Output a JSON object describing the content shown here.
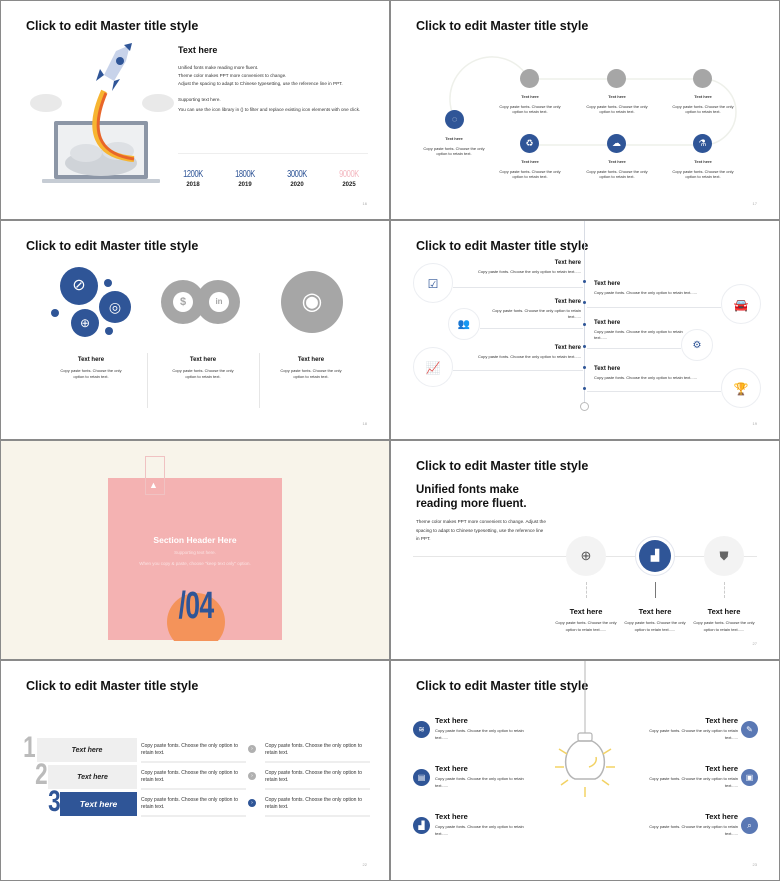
{
  "colors": {
    "accent": "#2f5597",
    "gray": "#a6a6a6",
    "pink": "#f4b2b2",
    "orange": "#f4935a",
    "cream": "#f8f4ea",
    "bulb_yellow": "#f2d264"
  },
  "slides": [
    {
      "title": "Click to edit Master title style",
      "page": "16",
      "heading": "Text here",
      "body_lines": [
        "Unified fonts make reading more fluent.",
        "Theme color makes PPT more convenient to change.",
        "Adjust the spacing to adapt to Chinese typesetting, use the reference line in PPT."
      ],
      "supporting": "Supporting text here.",
      "supporting_body": "You can use the icon library in   () to filter and replace existing icon elements with one click.",
      "stats": [
        {
          "value": "1200K",
          "year": "2018",
          "color": "#2f5597"
        },
        {
          "value": "1800K",
          "year": "2019",
          "color": "#2f5597"
        },
        {
          "value": "3000K",
          "year": "2020",
          "color": "#2f5597"
        },
        {
          "value": "9000K",
          "year": "2025",
          "color": "#f4b8c0"
        }
      ]
    },
    {
      "title": "Click to edit Master title style",
      "page": "17",
      "items": [
        {
          "icon": "lightbulb-icon",
          "label": "Text here",
          "desc": "Copy paste fonts. Choose the only option to retain text."
        },
        {
          "icon": "satellite-icon",
          "label": "Text here",
          "desc": "Copy paste fonts. Choose the only option to retain text."
        },
        {
          "icon": "tools-icon",
          "label": "Text here",
          "desc": "Copy paste fonts. Choose the only option to retain text."
        },
        {
          "icon": "wrench-icon",
          "label": "Text here",
          "desc": "Copy paste fonts. Choose the only option to retain text."
        },
        {
          "icon": "recycle-icon",
          "label": "Text here",
          "desc": "Copy paste fonts. Choose the only option to retain text."
        },
        {
          "icon": "cloud-upload-icon",
          "label": "Text here",
          "desc": "Copy paste fonts. Choose the only option to retain text."
        },
        {
          "icon": "flask-icon",
          "label": "Text here",
          "desc": "Copy paste fonts. Choose the only option to retain text."
        }
      ]
    },
    {
      "title": "Click to edit Master title style",
      "page": "18",
      "columns": [
        {
          "label": "Text here",
          "desc": "Copy paste fonts. Choose the only option to retain text."
        },
        {
          "label": "Text here",
          "desc": "Copy paste fonts. Choose the only option to retain text."
        },
        {
          "label": "Text here",
          "desc": "Copy paste fonts. Choose the only option to retain text."
        }
      ]
    },
    {
      "title": "Click to edit Master title style",
      "page": "19",
      "left": [
        {
          "icon": "checkbox-icon",
          "label": "Text here",
          "desc": "Copy paste fonts. Choose the only option to retain text......"
        },
        {
          "icon": "team-icon",
          "label": "Text here",
          "desc": "Copy paste fonts. Choose the only option to retain text......"
        },
        {
          "icon": "growth-chart-icon",
          "label": "Text here",
          "desc": "Copy paste fonts. Choose the only option to retain text......"
        }
      ],
      "right": [
        {
          "icon": "car-icon",
          "label": "Text here",
          "desc": "Copy paste fonts. Choose the only option to retain text......"
        },
        {
          "icon": "gear-icon",
          "label": "Text here",
          "desc": "Copy paste fonts. Choose the only option to retain text......"
        },
        {
          "icon": "trophy-icon",
          "label": "Text here",
          "desc": "Copy paste fonts. Choose the only option to retain text......"
        }
      ]
    },
    {
      "section_title": "Section Header Here",
      "supporting": "Supporting text here.",
      "note": "When you copy & paste, choose \"keep text only\" option.",
      "number": "/04"
    },
    {
      "title": "Click to edit Master title style",
      "page": "27",
      "heading": "Unified fonts make reading more fluent.",
      "body": "Theme color makes PPT more convenient to change. Adjust the spacing to adapt to Chinese typesetting, use the reference line in PPT.",
      "items": [
        {
          "icon": "globe-icon",
          "label": "Text here",
          "desc": "Copy paste fonts. Choose the only option to retain text......"
        },
        {
          "icon": "bar-chart-icon",
          "label": "Text here",
          "desc": "Copy paste fonts. Choose the only option to retain text......"
        },
        {
          "icon": "shield-icon",
          "label": "Text here",
          "desc": "Copy paste fonts. Choose the only option to retain text......"
        }
      ]
    },
    {
      "title": "Click to edit Master title style",
      "page": "22",
      "rows": [
        {
          "num": "1",
          "label": "Text here",
          "c1": "Copy paste fonts. Choose the only option to retain text.",
          "c2": "Copy paste fonts. Choose the only option to retain text."
        },
        {
          "num": "2",
          "label": "Text here",
          "c1": "Copy paste fonts. Choose the only option to retain text.",
          "c2": "Copy paste fonts. Choose the only option to retain text."
        },
        {
          "num": "3",
          "label": "Text here",
          "c1": "Copy paste fonts. Choose the only option to retain text.",
          "c2": "Copy paste fonts. Choose the only option to retain text."
        }
      ]
    },
    {
      "title": "Click to edit Master title style",
      "page": "23",
      "left": [
        {
          "icon": "wifi-icon",
          "label": "Text here",
          "desc": "Copy paste fonts. Choose the only option to retain text......"
        },
        {
          "icon": "clipboard-icon",
          "label": "Text here",
          "desc": "Copy paste fonts. Choose the only option to retain text......"
        },
        {
          "icon": "bar-chart-icon",
          "label": "Text here",
          "desc": "Copy paste fonts. Choose the only option to retain text......"
        }
      ],
      "right": [
        {
          "icon": "pencil-icon",
          "label": "Text here",
          "desc": "Copy paste fonts. Choose the only option to retain text......"
        },
        {
          "icon": "box-icon",
          "label": "Text here",
          "desc": "Copy paste fonts. Choose the only option to retain text......"
        },
        {
          "icon": "search-icon",
          "label": "Text here",
          "desc": "Copy paste fonts. Choose the only option to retain text......"
        }
      ]
    }
  ]
}
